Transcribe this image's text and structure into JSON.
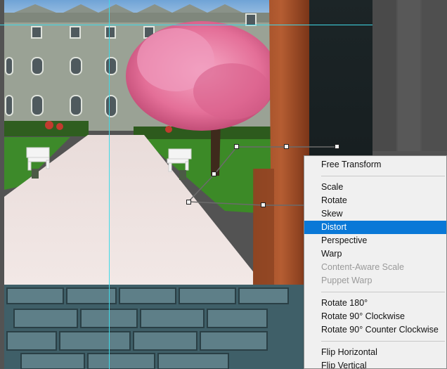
{
  "menu": {
    "items": [
      {
        "label": "Free Transform",
        "state": "enabled"
      },
      {
        "separator": true
      },
      {
        "label": "Scale",
        "state": "enabled"
      },
      {
        "label": "Rotate",
        "state": "enabled"
      },
      {
        "label": "Skew",
        "state": "enabled"
      },
      {
        "label": "Distort",
        "state": "selected"
      },
      {
        "label": "Perspective",
        "state": "enabled"
      },
      {
        "label": "Warp",
        "state": "enabled"
      },
      {
        "label": "Content-Aware Scale",
        "state": "disabled"
      },
      {
        "label": "Puppet Warp",
        "state": "disabled"
      },
      {
        "separator": true
      },
      {
        "label": "Rotate 180°",
        "state": "enabled"
      },
      {
        "label": "Rotate 90° Clockwise",
        "state": "enabled"
      },
      {
        "label": "Rotate 90° Counter Clockwise",
        "state": "enabled"
      },
      {
        "separator": true
      },
      {
        "label": "Flip Horizontal",
        "state": "enabled"
      },
      {
        "label": "Flip Vertical",
        "state": "enabled"
      }
    ]
  },
  "colors": {
    "guide": "#3fd8e6",
    "menu_bg": "#f0f0f0",
    "menu_highlight": "#0a78d7",
    "menu_disabled_text": "#9a9a9a",
    "workspace_bg": "#535353"
  },
  "icons": {
    "transform_handle": "square-handle-icon"
  }
}
